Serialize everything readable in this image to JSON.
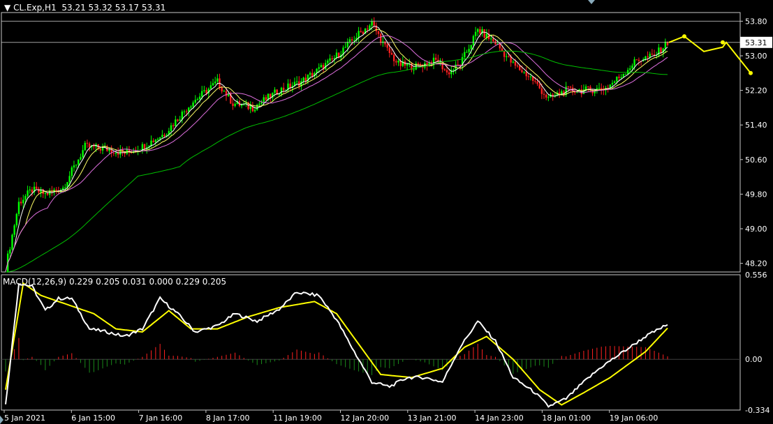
{
  "header": {
    "symbol": "CL.Exp,H1",
    "ohlc": "53.21 53.32 53.17 53.31",
    "menu_icon": "triangle-down-icon"
  },
  "macd_header": "MACD(12,26,9) 0.229 0.205 0.031 0.000 0.229 0.205",
  "chart_data": [
    {
      "type": "candlestick",
      "panel": "price",
      "ylim": [
        48.0,
        54.0
      ],
      "y_ticks": [
        "53.80",
        "53.00",
        "52.20",
        "51.40",
        "50.60",
        "49.80",
        "49.00",
        "48.20"
      ],
      "current_price": "53.31",
      "horizontal_lines": [
        53.8,
        53.31
      ],
      "x_ticks": [
        "5 Jan 2021",
        "6 Jan 15:00",
        "7 Jan 16:00",
        "8 Jan 17:00",
        "11 Jan 19:00",
        "12 Jan 20:00",
        "13 Jan 21:00",
        "14 Jan 23:00",
        "18 Jan 01:00",
        "19 Jan 06:00"
      ],
      "close_path": [
        [
          0,
          48.1
        ],
        [
          6,
          49.6
        ],
        [
          12,
          49.9
        ],
        [
          18,
          49.8
        ],
        [
          26,
          49.95
        ],
        [
          36,
          50.9
        ],
        [
          45,
          50.85
        ],
        [
          54,
          50.75
        ],
        [
          62,
          50.9
        ],
        [
          72,
          51.2
        ],
        [
          84,
          51.9
        ],
        [
          96,
          52.4
        ],
        [
          103,
          51.9
        ],
        [
          112,
          51.8
        ],
        [
          124,
          52.2
        ],
        [
          134,
          52.4
        ],
        [
          148,
          52.9
        ],
        [
          160,
          53.5
        ],
        [
          166,
          53.75
        ],
        [
          172,
          53.2
        ],
        [
          178,
          52.8
        ],
        [
          186,
          52.75
        ],
        [
          196,
          52.9
        ],
        [
          200,
          52.6
        ],
        [
          206,
          52.8
        ],
        [
          214,
          53.6
        ],
        [
          222,
          53.3
        ],
        [
          230,
          52.8
        ],
        [
          238,
          52.5
        ],
        [
          246,
          52.0
        ],
        [
          254,
          52.2
        ],
        [
          262,
          52.2
        ],
        [
          272,
          52.25
        ],
        [
          278,
          52.5
        ],
        [
          286,
          52.9
        ],
        [
          294,
          53.0
        ],
        [
          300,
          53.31
        ]
      ],
      "bull_color": "#00ff00",
      "bear_color": "#ff2020",
      "moving_averages": [
        {
          "period": "fast",
          "color": "#ffffff"
        },
        {
          "period": "medium",
          "color": "#ffff66"
        },
        {
          "period": "slow",
          "color": "#e070e0"
        },
        {
          "period": "long",
          "color": "#00c000"
        }
      ],
      "forecast_arrows": {
        "color": "#ffff00",
        "points": [
          [
            53.31
          ],
          [
            53.45
          ],
          [
            53.1
          ],
          [
            53.2
          ],
          [
            53.31
          ],
          [
            52.6
          ]
        ]
      }
    },
    {
      "type": "macd",
      "panel": "indicator",
      "params": "12,26,9",
      "ylim": [
        -0.334,
        0.556
      ],
      "y_ticks": [
        "0.556",
        "0.00",
        "-0.334"
      ],
      "macd_path": [
        [
          0,
          -0.3
        ],
        [
          6,
          0.5
        ],
        [
          12,
          0.48
        ],
        [
          18,
          0.32
        ],
        [
          24,
          0.4
        ],
        [
          30,
          0.4
        ],
        [
          38,
          0.2
        ],
        [
          46,
          0.18
        ],
        [
          54,
          0.15
        ],
        [
          62,
          0.2
        ],
        [
          70,
          0.4
        ],
        [
          78,
          0.3
        ],
        [
          86,
          0.18
        ],
        [
          96,
          0.22
        ],
        [
          104,
          0.3
        ],
        [
          114,
          0.25
        ],
        [
          124,
          0.33
        ],
        [
          132,
          0.44
        ],
        [
          142,
          0.42
        ],
        [
          150,
          0.26
        ],
        [
          158,
          0.05
        ],
        [
          166,
          -0.15
        ],
        [
          174,
          -0.18
        ],
        [
          182,
          -0.12
        ],
        [
          190,
          -0.12
        ],
        [
          198,
          -0.15
        ],
        [
          206,
          0.08
        ],
        [
          214,
          0.25
        ],
        [
          222,
          0.12
        ],
        [
          230,
          -0.12
        ],
        [
          240,
          -0.22
        ],
        [
          246,
          -0.31
        ],
        [
          254,
          -0.26
        ],
        [
          262,
          -0.15
        ],
        [
          270,
          -0.05
        ],
        [
          280,
          0.05
        ],
        [
          290,
          0.15
        ],
        [
          300,
          0.229
        ]
      ],
      "signal_path": [
        [
          0,
          -0.2
        ],
        [
          8,
          0.5
        ],
        [
          16,
          0.42
        ],
        [
          28,
          0.36
        ],
        [
          40,
          0.3
        ],
        [
          50,
          0.2
        ],
        [
          62,
          0.18
        ],
        [
          74,
          0.32
        ],
        [
          84,
          0.2
        ],
        [
          96,
          0.2
        ],
        [
          110,
          0.28
        ],
        [
          124,
          0.34
        ],
        [
          140,
          0.38
        ],
        [
          150,
          0.3
        ],
        [
          160,
          0.1
        ],
        [
          170,
          -0.1
        ],
        [
          184,
          -0.12
        ],
        [
          198,
          -0.06
        ],
        [
          208,
          0.08
        ],
        [
          218,
          0.15
        ],
        [
          230,
          0.0
        ],
        [
          242,
          -0.2
        ],
        [
          252,
          -0.3
        ],
        [
          262,
          -0.22
        ],
        [
          274,
          -0.12
        ],
        [
          290,
          0.05
        ],
        [
          300,
          0.205
        ]
      ],
      "macd_color": "#ffffff",
      "signal_color": "#ffff00",
      "hist_pos_color": "#ff2020",
      "hist_neg_color": "#1a8a1a"
    }
  ]
}
